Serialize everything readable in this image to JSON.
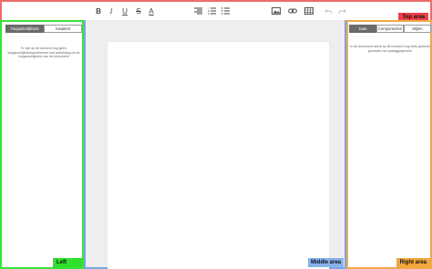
{
  "areas": {
    "top": "Top area",
    "left": "Left area",
    "middle": "Middle area",
    "right": "Right area"
  },
  "toolbar": {
    "icons": [
      "bold-icon",
      "italic-icon",
      "underline-icon",
      "strikethrough-icon",
      "text-color-icon",
      "align-icon",
      "ordered-list-icon",
      "bullet-list-icon",
      "image-icon",
      "link-icon",
      "table-icon",
      "undo-icon",
      "redo-icon"
    ],
    "bold": "B",
    "italic": "I",
    "underline": "U",
    "strike": "S",
    "textcolor": "A"
  },
  "left_panel": {
    "tabs": [
      {
        "label": "Toegankelijkheid",
        "active": true
      },
      {
        "label": "Kwaliteit",
        "active": false
      }
    ],
    "message": "Er zijn op dit moment nog geen toegankelijkheidsproblemen met betrekking tot de toegankelijkheid van het document"
  },
  "right_panel": {
    "tabs": [
      {
        "label": "Data",
        "active": true
      },
      {
        "label": "Componenten",
        "active": false
      },
      {
        "label": "Stijlen",
        "active": false
      }
    ],
    "message": "In dit document wordt op dit moment nog niets gebruikt gemaakt van opslaggegevens"
  }
}
